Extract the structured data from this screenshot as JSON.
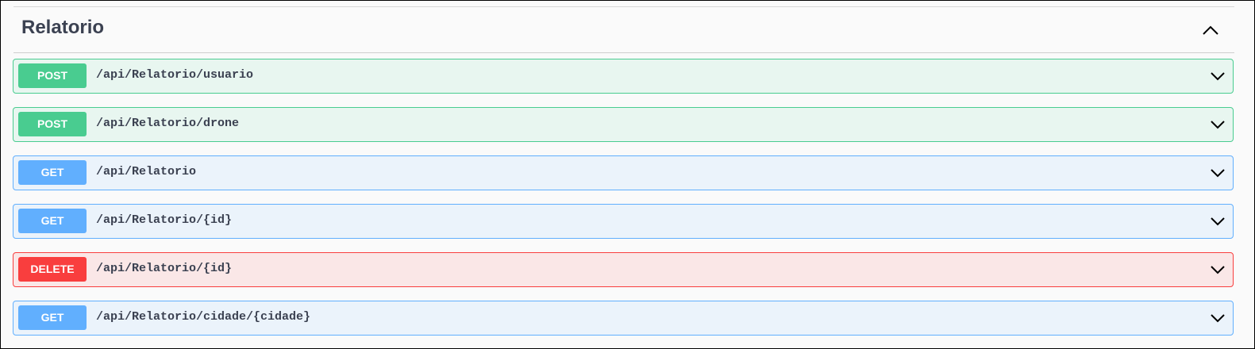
{
  "section": {
    "title": "Relatorio",
    "toggle_icon": "chevron-up-icon"
  },
  "operations": [
    {
      "method": "POST",
      "path": "/api/Relatorio/usuario"
    },
    {
      "method": "POST",
      "path": "/api/Relatorio/drone"
    },
    {
      "method": "GET",
      "path": "/api/Relatorio"
    },
    {
      "method": "GET",
      "path": "/api/Relatorio/{id}"
    },
    {
      "method": "DELETE",
      "path": "/api/Relatorio/{id}"
    },
    {
      "method": "GET",
      "path": "/api/Relatorio/cidade/{cidade}"
    }
  ],
  "colors": {
    "post": "#49cc90",
    "get": "#61affe",
    "delete": "#f93e3e",
    "text": "#3b4151"
  }
}
